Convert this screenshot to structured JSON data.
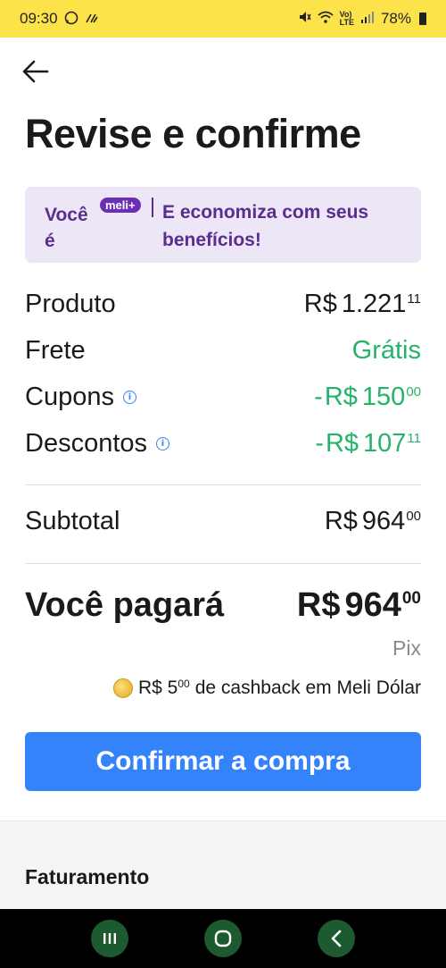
{
  "status_bar": {
    "time": "09:30",
    "battery": "78%"
  },
  "header": {
    "title": "Revise e confirme"
  },
  "meli_banner": {
    "voce": "Você é",
    "badge": "meli+",
    "text": "E economiza com seus benefícios!"
  },
  "summary": {
    "rows": [
      {
        "label": "Produto",
        "currency": "R$",
        "amount": "1.221",
        "cents": "11"
      },
      {
        "label": "Frete",
        "value": "Grátis"
      },
      {
        "label": "Cupons",
        "prefix": "-",
        "currency": "R$",
        "amount": "150",
        "cents": "00"
      },
      {
        "label": "Descontos",
        "prefix": "-",
        "currency": "R$",
        "amount": "107",
        "cents": "11"
      }
    ],
    "subtotal": {
      "label": "Subtotal",
      "currency": "R$",
      "amount": "964",
      "cents": "00"
    }
  },
  "total": {
    "label": "Você pagará",
    "currency": "R$",
    "amount": "964",
    "cents": "00",
    "payment_method": "Pix"
  },
  "cashback": {
    "currency": "R$",
    "amount": "5",
    "cents": "00",
    "text": "de cashback em Meli Dólar"
  },
  "confirm_button": {
    "label": "Confirmar a compra"
  },
  "billing": {
    "title": "Faturamento"
  },
  "colors": {
    "brand_yellow": "#fde34a",
    "primary_blue": "#3483fa",
    "green": "#00a650",
    "meli_purple": "#5a2d8f"
  },
  "icons": [
    "whatsapp-icon",
    "mute-icon",
    "wifi-icon",
    "signal-icon",
    "battery-icon",
    "back-arrow-icon",
    "info-icon",
    "coin-icon",
    "recents-icon",
    "home-icon",
    "back-nav-icon"
  ]
}
